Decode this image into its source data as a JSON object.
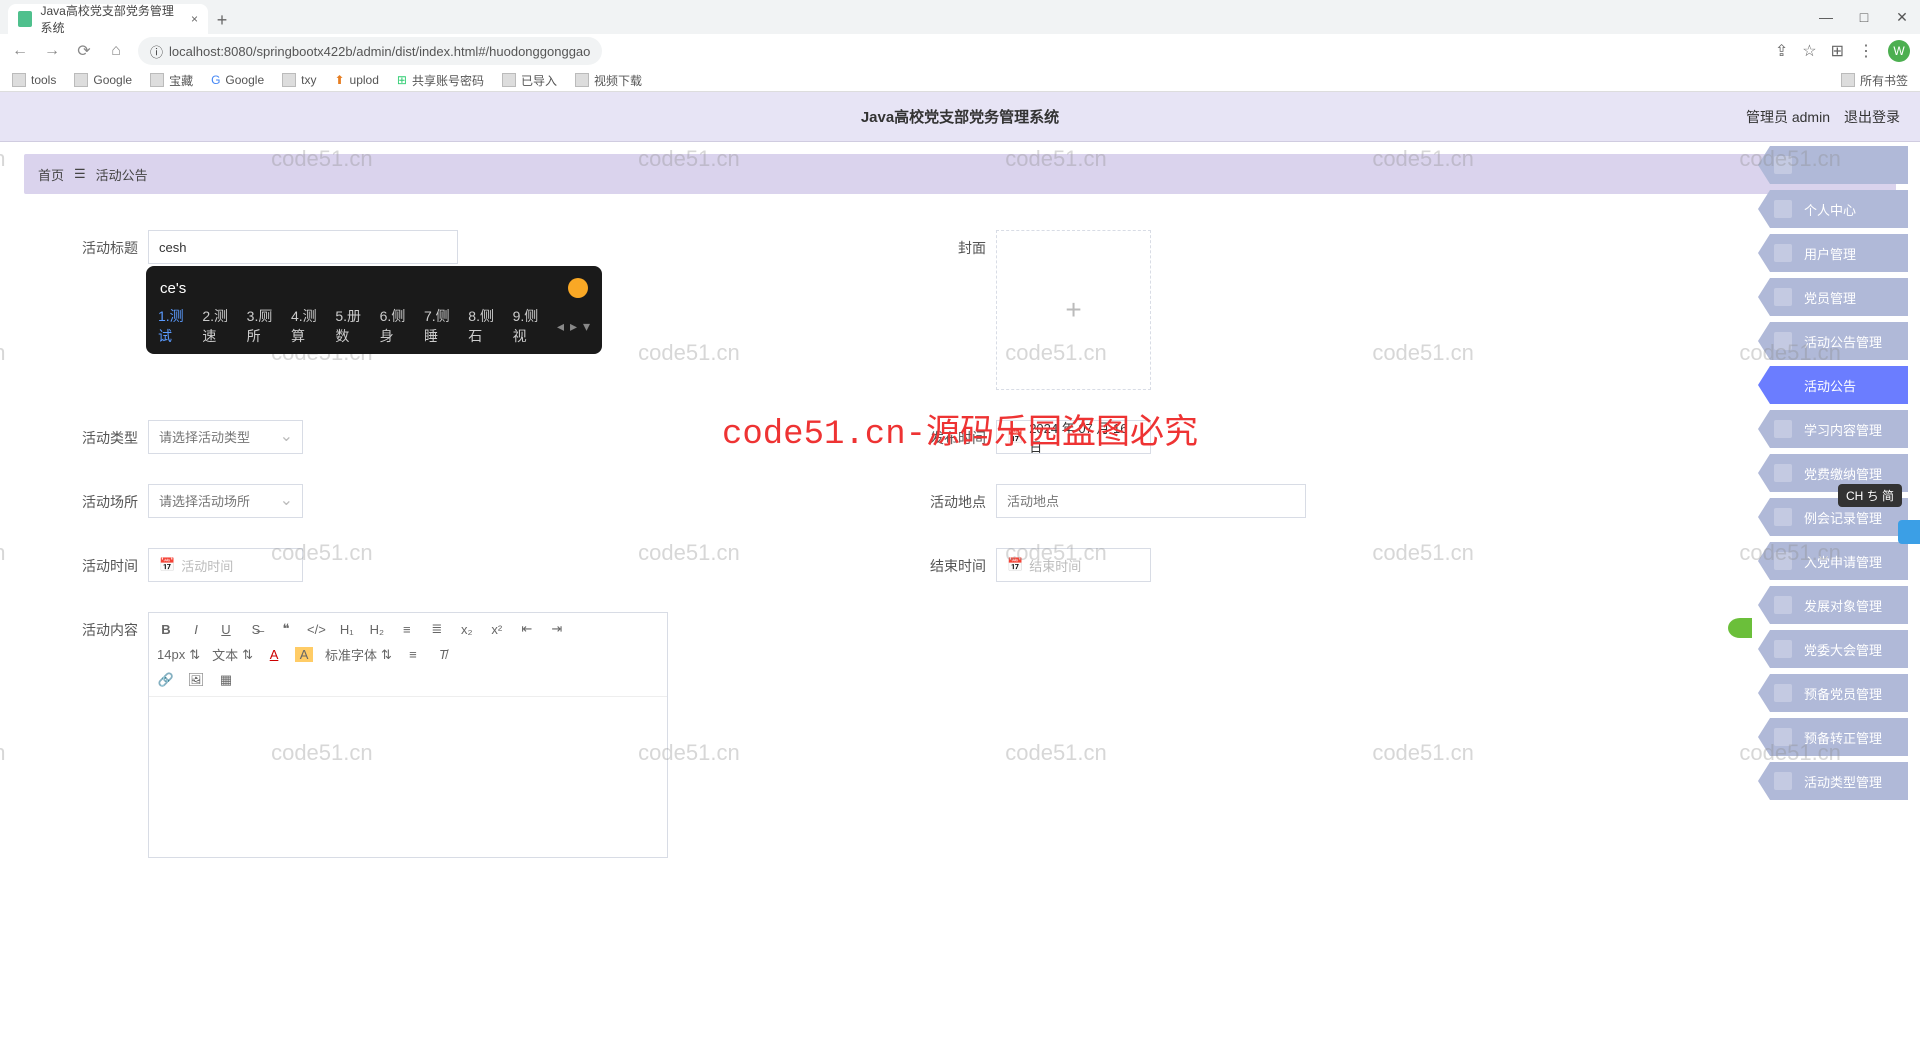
{
  "browser": {
    "tab_title": "Java高校党支部党务管理系统",
    "url": "localhost:8080/springbootx422b/admin/dist/index.html#/huodonggonggao",
    "bookmarks": [
      "tools",
      "Google",
      "宝藏",
      "Google",
      "txy",
      "uplod",
      "共享账号密码",
      "已导入",
      "视频下载"
    ],
    "bm_right": "所有书签"
  },
  "header": {
    "title": "Java高校党支部党务管理系统",
    "role": "管理员 admin",
    "logout": "退出登录"
  },
  "breadcrumb": {
    "home": "首页",
    "sep": "☰",
    "current": "活动公告"
  },
  "form": {
    "title_label": "活动标题",
    "title_value": "cesh",
    "cover_label": "封面",
    "type_label": "活动类型",
    "type_placeholder": "请选择活动类型",
    "publish_label": "发布时间",
    "publish_value": "2024 年 07 月 16 日",
    "place_label": "活动场所",
    "place_placeholder": "请选择活动场所",
    "addr_label": "活动地点",
    "addr_placeholder": "活动地点",
    "time_label": "活动时间",
    "time_placeholder": "活动时间",
    "end_label": "结束时间",
    "end_placeholder": "结束时间",
    "content_label": "活动内容"
  },
  "editor": {
    "fontsize": "14px",
    "textmode": "文本",
    "fontfamily": "标准字体"
  },
  "ime": {
    "typed": "ce's",
    "candidates": [
      "1.测试",
      "2.测速",
      "3.厕所",
      "4.测算",
      "5.册数",
      "6.侧身",
      "7.侧睡",
      "8.侧石",
      "9.侧视"
    ],
    "badge": "CH ち 简"
  },
  "sidebar": [
    {
      "label": "",
      "icon": "home"
    },
    {
      "label": "个人中心",
      "icon": "user"
    },
    {
      "label": "用户管理",
      "icon": "users"
    },
    {
      "label": "党员管理",
      "icon": "list"
    },
    {
      "label": "活动公告管理",
      "icon": "list"
    },
    {
      "label": "活动公告",
      "icon": "",
      "active": true
    },
    {
      "label": "学习内容管理",
      "icon": "grid"
    },
    {
      "label": "党费缴纳管理",
      "icon": "user"
    },
    {
      "label": "例会记录管理",
      "icon": "pin"
    },
    {
      "label": "入党申请管理",
      "icon": "list"
    },
    {
      "label": "发展对象管理",
      "icon": "screen"
    },
    {
      "label": "党委大会管理",
      "icon": "list"
    },
    {
      "label": "预备党员管理",
      "icon": "grid"
    },
    {
      "label": "预备转正管理",
      "icon": "grid"
    },
    {
      "label": "活动类型管理",
      "icon": "list"
    }
  ],
  "watermark": {
    "text": "code51.cn",
    "center": "code51.cn-源码乐园盗图必究"
  }
}
